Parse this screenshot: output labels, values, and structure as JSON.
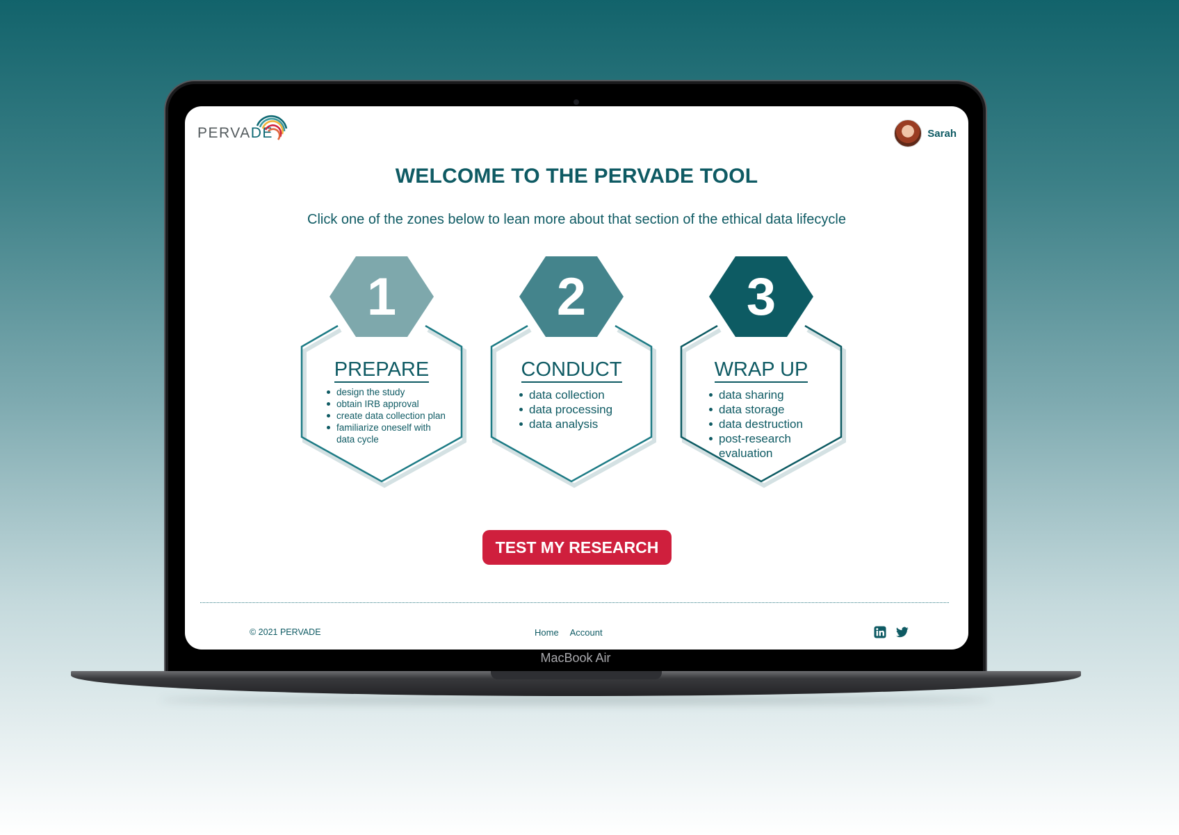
{
  "device": {
    "model_label": "MacBook Air"
  },
  "header": {
    "logo_text_main": "PERVA",
    "logo_text_accent": "DE",
    "user_name": "Sarah"
  },
  "main": {
    "title": "WELCOME TO THE PERVADE TOOL",
    "subtitle": "Click one of the zones below to lean more about that section of the ethical data lifecycle",
    "zones": [
      {
        "number": "1",
        "title": "PREPARE",
        "items": [
          "design the study",
          "obtain IRB approval",
          "create data collection plan",
          "familiarize oneself with data cycle"
        ],
        "color": "#7ea8ac"
      },
      {
        "number": "2",
        "title": "CONDUCT",
        "items": [
          "data collection",
          "data processing",
          "data analysis"
        ],
        "color": "#44848c"
      },
      {
        "number": "3",
        "title": "WRAP UP",
        "items": [
          "data sharing",
          "data storage",
          "data destruction",
          "post-research evaluation"
        ],
        "color": "#0d5b63"
      }
    ],
    "cta_label": "TEST MY RESEARCH"
  },
  "footer": {
    "copyright": "© 2021 PERVADE",
    "nav": [
      "Home",
      "Account"
    ],
    "social_icons": [
      "linkedin-icon",
      "twitter-icon"
    ]
  },
  "colors": {
    "brand_teal": "#0e5a63",
    "cta_red": "#cf1f3d",
    "zone_1": "#7ea8ac",
    "zone_2": "#44848c",
    "zone_3": "#0d5b63"
  }
}
